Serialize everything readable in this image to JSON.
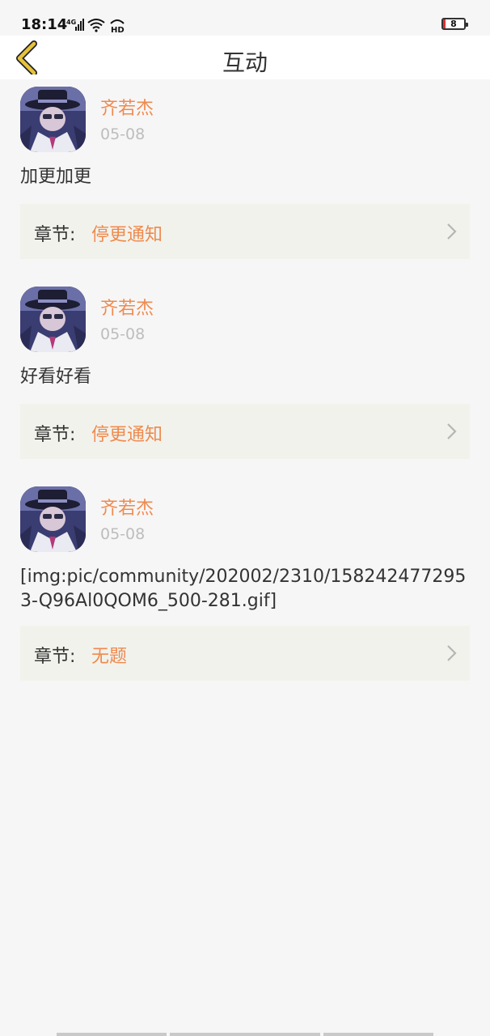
{
  "status": {
    "time": "18:14",
    "network": "4G",
    "hd": "HD",
    "battery": "8"
  },
  "header": {
    "title": "互动",
    "back_icon": "chevron-left-icon"
  },
  "posts": [
    {
      "author": "齐若杰",
      "date": "05-08",
      "text": "加更加更",
      "chapter_label": "章节:",
      "chapter_name": "停更通知"
    },
    {
      "author": "齐若杰",
      "date": "05-08",
      "text": "好看好看",
      "chapter_label": "章节:",
      "chapter_name": "停更通知"
    },
    {
      "author": "齐若杰",
      "date": "05-08",
      "text": "[img:pic/community/202002/2310/1582424772953-Q96Al0QOM6_500-281.gif]",
      "chapter_label": "章节:",
      "chapter_name": "无题"
    }
  ],
  "colors": {
    "accent": "#ee8a4e",
    "back_arrow": "#e7c23a",
    "card_bg": "#f2f2ec"
  }
}
